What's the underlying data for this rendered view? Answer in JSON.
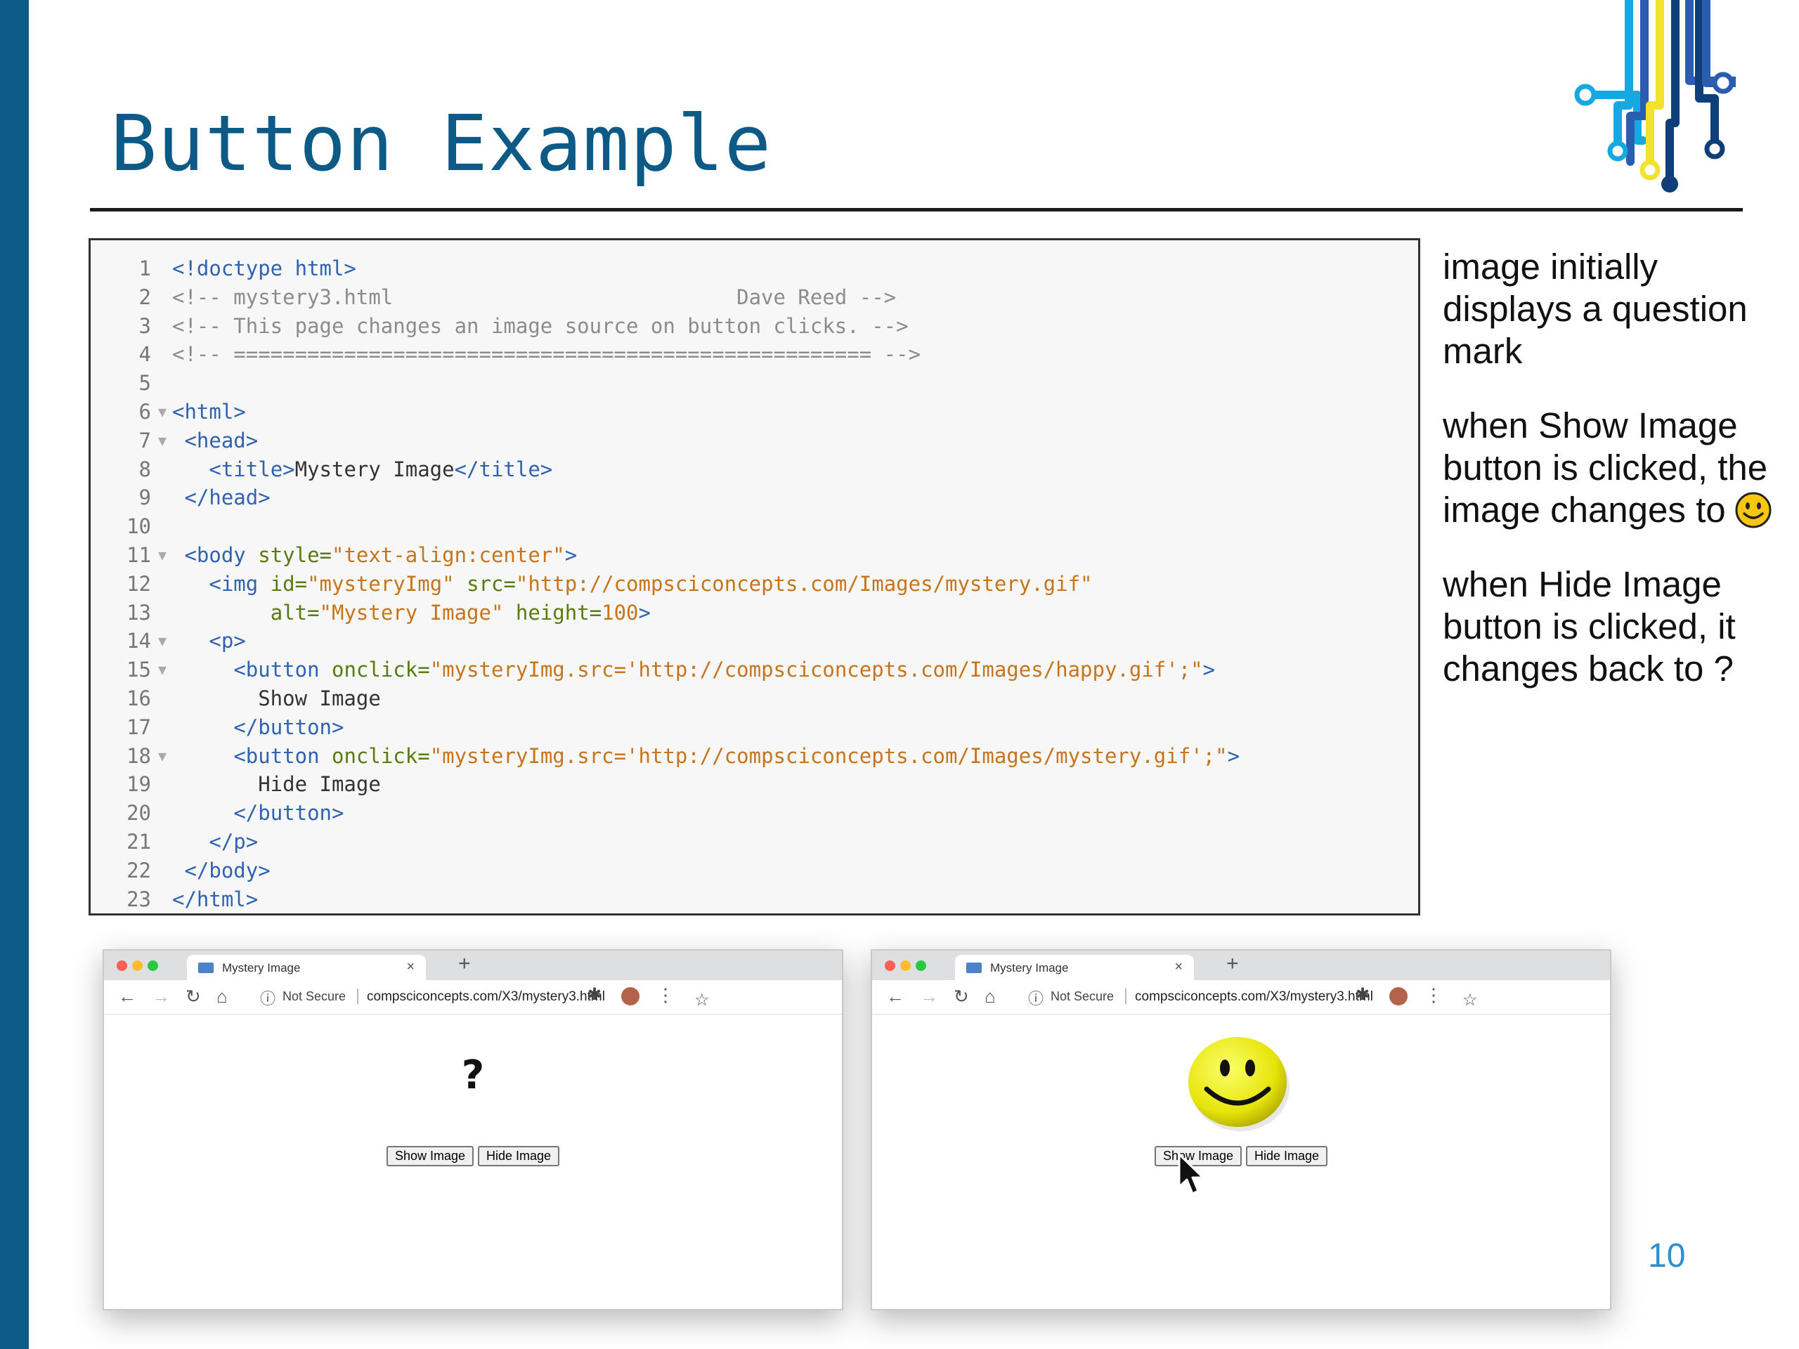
{
  "slide": {
    "title": "Button Example",
    "page_number": "10"
  },
  "code": {
    "lines": [
      [
        "1",
        "",
        [
          [
            "t-tag",
            "<!doctype html>"
          ]
        ]
      ],
      [
        "2",
        "",
        [
          [
            "t-com",
            "<!-- mystery3.html                            Dave Reed -->"
          ]
        ]
      ],
      [
        "3",
        "",
        [
          [
            "t-com",
            "<!-- This page changes an image source on button clicks. -->"
          ]
        ]
      ],
      [
        "4",
        "",
        [
          [
            "t-com",
            "<!-- ==================================================== -->"
          ]
        ]
      ],
      [
        "5",
        "",
        []
      ],
      [
        "6",
        "▼",
        [
          [
            "t-tag",
            "<html>"
          ]
        ]
      ],
      [
        "7",
        "▼",
        [
          [
            "t-txt",
            " "
          ],
          [
            "t-tag",
            "<head>"
          ]
        ]
      ],
      [
        "8",
        "",
        [
          [
            "t-txt",
            "   "
          ],
          [
            "t-tag",
            "<title>"
          ],
          [
            "t-txt",
            "Mystery Image"
          ],
          [
            "t-tag",
            "</title>"
          ]
        ]
      ],
      [
        "9",
        "",
        [
          [
            "t-txt",
            " "
          ],
          [
            "t-tag",
            "</head>"
          ]
        ]
      ],
      [
        "10",
        "",
        []
      ],
      [
        "11",
        "▼",
        [
          [
            "t-txt",
            " "
          ],
          [
            "t-tag",
            "<body "
          ],
          [
            "t-attr",
            "style="
          ],
          [
            "t-str",
            "\"text-align:center\""
          ],
          [
            "t-tag",
            ">"
          ]
        ]
      ],
      [
        "12",
        "",
        [
          [
            "t-txt",
            "   "
          ],
          [
            "t-tag",
            "<img "
          ],
          [
            "t-attr",
            "id="
          ],
          [
            "t-str",
            "\"mysteryImg\""
          ],
          [
            "t-attr",
            " src="
          ],
          [
            "t-str",
            "\"http://compsciconcepts.com/Images/mystery.gif\""
          ]
        ]
      ],
      [
        "13",
        "",
        [
          [
            "t-txt",
            "        "
          ],
          [
            "t-attr",
            "alt="
          ],
          [
            "t-str",
            "\"Mystery Image\""
          ],
          [
            "t-attr",
            " height="
          ],
          [
            "t-str",
            "100"
          ],
          [
            "t-tag",
            ">"
          ]
        ]
      ],
      [
        "14",
        "▼",
        [
          [
            "t-txt",
            "   "
          ],
          [
            "t-tag",
            "<p>"
          ]
        ]
      ],
      [
        "15",
        "▼",
        [
          [
            "t-txt",
            "     "
          ],
          [
            "t-tag",
            "<button "
          ],
          [
            "t-attr",
            "onclick="
          ],
          [
            "t-str",
            "\"mysteryImg.src='http://compsciconcepts.com/Images/happy.gif';\""
          ],
          [
            "t-tag",
            ">"
          ]
        ]
      ],
      [
        "16",
        "",
        [
          [
            "t-txt",
            "       Show Image"
          ]
        ]
      ],
      [
        "17",
        "",
        [
          [
            "t-txt",
            "     "
          ],
          [
            "t-tag",
            "</button>"
          ]
        ]
      ],
      [
        "18",
        "▼",
        [
          [
            "t-txt",
            "     "
          ],
          [
            "t-tag",
            "<button "
          ],
          [
            "t-attr",
            "onclick="
          ],
          [
            "t-str",
            "\"mysteryImg.src='http://compsciconcepts.com/Images/mystery.gif';\""
          ],
          [
            "t-tag",
            ">"
          ]
        ]
      ],
      [
        "19",
        "",
        [
          [
            "t-txt",
            "       Hide Image"
          ]
        ]
      ],
      [
        "20",
        "",
        [
          [
            "t-txt",
            "     "
          ],
          [
            "t-tag",
            "</button>"
          ]
        ]
      ],
      [
        "21",
        "",
        [
          [
            "t-txt",
            "   "
          ],
          [
            "t-tag",
            "</p>"
          ]
        ]
      ],
      [
        "22",
        "",
        [
          [
            "t-txt",
            " "
          ],
          [
            "t-tag",
            "</body>"
          ]
        ]
      ],
      [
        "23",
        "",
        [
          [
            "t-tag",
            "</html>"
          ]
        ]
      ]
    ]
  },
  "notes": {
    "n1": "image initially displays a question mark",
    "n2": "when Show Image button is clicked, the image changes to",
    "n3": "when Hide Image button is clicked, it changes back to ?"
  },
  "browser": {
    "tab_title": "Mystery Image",
    "close_glyph": "×",
    "new_tab_glyph": "+",
    "back_glyph": "←",
    "forward_glyph": "→",
    "reload_glyph": "↻",
    "home_glyph": "⌂",
    "info_glyph": "ⓘ",
    "not_secure": "Not Secure",
    "url": "compsciconcepts.com/X3/mystery3.html",
    "star_glyph": "☆",
    "extensions_glyph": "✱",
    "menu_glyph": "⋮",
    "show_label": "Show Image",
    "hide_label": "Hide Image",
    "question_mark": "?"
  },
  "colors": {
    "accent_blue": "#0e5a86",
    "page_number": "#2e8fd0",
    "code_tag": "#2f62b0",
    "code_attr": "#5a7a12",
    "code_string": "#c6751c",
    "code_comment": "#8c8c8c"
  },
  "icons": [
    "circuit-logo",
    "smiley-icon",
    "cursor-arrow-icon"
  ]
}
